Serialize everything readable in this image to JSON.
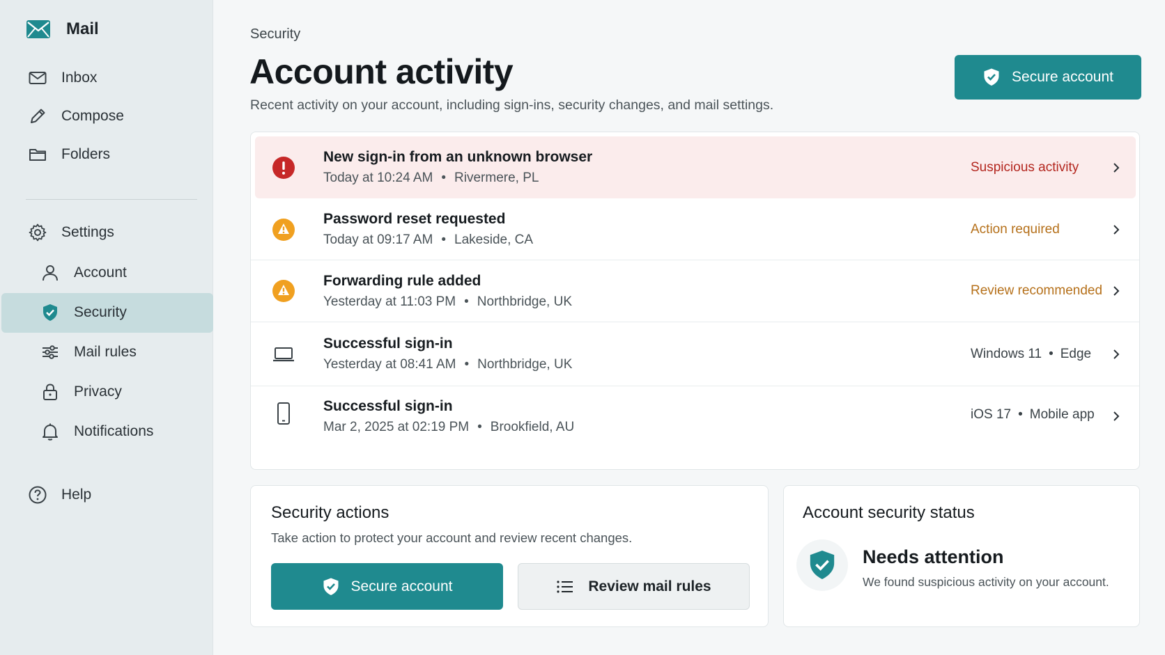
{
  "app": {
    "name": "Mail"
  },
  "sidebar": {
    "nav": [
      {
        "label": "Inbox",
        "icon": "mail-icon"
      },
      {
        "label": "Compose",
        "icon": "pencil-icon"
      },
      {
        "label": "Folders",
        "icon": "folder-icon"
      }
    ],
    "settings": {
      "label": "Settings",
      "icon": "gear-icon"
    },
    "settings_items": [
      {
        "label": "Account",
        "icon": "person-icon"
      },
      {
        "label": "Security",
        "icon": "shield-icon",
        "active": true
      },
      {
        "label": "Mail rules",
        "icon": "sliders-icon"
      },
      {
        "label": "Privacy",
        "icon": "lock-icon"
      },
      {
        "label": "Notifications",
        "icon": "bell-icon"
      }
    ],
    "help": {
      "label": "Help",
      "icon": "help-icon"
    }
  },
  "page": {
    "breadcrumb": "Security",
    "title": "Account activity",
    "subtitle": "Recent activity on your account, including sign-ins, security changes, and mail settings.",
    "secure_button": "Secure account"
  },
  "activity": [
    {
      "title": "New sign-in from an unknown browser",
      "time": "Today at 10:24 AM",
      "location": "Rivermere, PL",
      "status": "Suspicious activity",
      "status_color": "#b3261e",
      "icon": "alert-icon"
    },
    {
      "title": "Password reset requested",
      "time": "Today at 09:17 AM",
      "location": "Lakeside, CA",
      "status": "Action required",
      "status_color": "#b5701a",
      "icon": "warning-icon"
    },
    {
      "title": "Forwarding rule added",
      "time": "Yesterday at 11:03 PM",
      "location": "Northbridge, UK",
      "status": "Review recommended",
      "status_color": "#b5701a",
      "icon": "warning-icon"
    },
    {
      "title": "Successful sign-in",
      "time": "Yesterday at 08:41 AM",
      "location": "Northbridge, UK",
      "device_os": "Windows 11",
      "device_app": "Edge",
      "icon": "laptop-icon"
    },
    {
      "title": "Successful sign-in",
      "time": "Mar 2, 2025 at 02:19 PM",
      "location": "Brookfield, AU",
      "device_os": "iOS 17",
      "device_app": "Mobile app",
      "icon": "phone-icon"
    }
  ],
  "security_actions": {
    "title": "Security actions",
    "description": "Take action to protect your account and review recent changes.",
    "secure_button": "Secure account",
    "review_button": "Review mail rules"
  },
  "status_card": {
    "title": "Account security status",
    "status": "Needs attention",
    "message": "We found suspicious activity on your account."
  },
  "colors": {
    "accent": "#1f8a8f",
    "sidebar_bg": "#e6ecee",
    "active_bg": "#c6dcde",
    "danger": "#c62828",
    "warning": "#f0a020"
  }
}
